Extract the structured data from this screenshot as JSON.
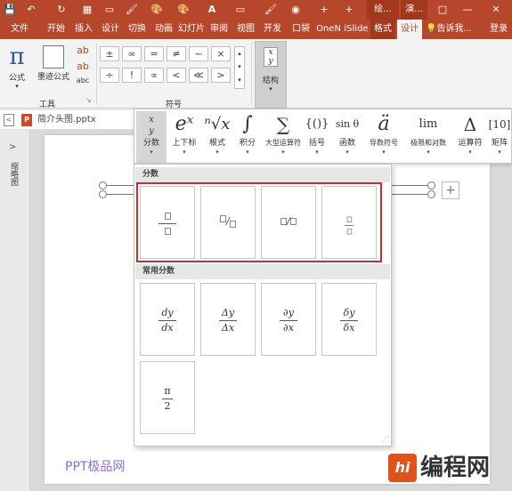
{
  "qat": {
    "title_left": "绘...",
    "title_right": "演...",
    "min": "—",
    "restore": "□",
    "close": "✕",
    "save_glyph": "💾",
    "undo_glyph": "↶",
    "redo_glyph": "↻",
    "grid_glyph": "▦",
    "brush_glyph": "🖌",
    "paint_glyph": "🎨",
    "fontcolor_glyph": "A",
    "box_glyph": "▭",
    "plus_glyph": "+",
    "disk_glyph": "◉"
  },
  "tabs": [
    "文件",
    "开始",
    "插入",
    "设计",
    "切换",
    "动画",
    "幻灯片",
    "审阅",
    "视图",
    "开发",
    "口袋",
    "OneN",
    "iSlide",
    "格式",
    "设计"
  ],
  "tell_me": "告诉我...",
  "login": "登录",
  "ribbon": {
    "equation_label": "公式",
    "ink_label": "墨迹公式",
    "abc_label": "abc",
    "tools_group": "工具",
    "symbols_group": "符号",
    "structure_label": "结构",
    "symbols": [
      "±",
      "∞",
      "=",
      "≠",
      "~",
      "×",
      "÷",
      "!",
      "∝",
      "<",
      "≪",
      ">"
    ],
    "launcher_glyph": "↘",
    "scroll_up": "▴",
    "scroll_down": "▾",
    "scroll_more": "▾",
    "pi_glyph": "π"
  },
  "file": {
    "name": "简介头图.pptx",
    "collapse_glyph": "<"
  },
  "left_panel": {
    "arrow": ">",
    "label": "缩略图"
  },
  "structures": [
    {
      "glyph": "x/y",
      "label": "分数",
      "arrow": "▾"
    },
    {
      "glyph": "eˣ",
      "label": "上下标",
      "arrow": "▾"
    },
    {
      "glyph": "ⁿ√x",
      "label": "根式",
      "arrow": "▾"
    },
    {
      "glyph": "∫",
      "label": "积分",
      "arrow": "▾"
    },
    {
      "glyph": "∑",
      "label": "大型运算符",
      "arrow": "▾"
    },
    {
      "glyph": "{()}",
      "label": "括号",
      "arrow": "▾"
    },
    {
      "glyph": "sin θ",
      "label": "函数",
      "arrow": "▾"
    },
    {
      "glyph": "ä",
      "label": "导数符号",
      "arrow": "▾"
    },
    {
      "glyph": "lim",
      "label": "极限和对数",
      "arrow": "▾"
    },
    {
      "glyph": "Δ",
      "label": "运算符",
      "arrow": "▾"
    },
    {
      "glyph": "[10]",
      "label": "矩阵",
      "arrow": "▾"
    }
  ],
  "dropdown": {
    "section1": "分数",
    "section2": "常用分数",
    "fractions": [
      {
        "name": "stacked"
      },
      {
        "name": "skewed",
        "sep": "/"
      },
      {
        "name": "linear",
        "sep": "/"
      },
      {
        "name": "small"
      }
    ],
    "common": [
      {
        "num": "dy",
        "den": "dx"
      },
      {
        "num": "Δy",
        "den": "Δx"
      },
      {
        "num": "∂y",
        "den": "∂x"
      },
      {
        "num": "δy",
        "den": "δx"
      },
      {
        "num": "π",
        "den": "2"
      }
    ],
    "resize_glyph": "⋰"
  },
  "slide": {
    "add_glyph": "+"
  },
  "watermark": {
    "left": "PPT极品网",
    "right": "编程网",
    "logo": "hi"
  },
  "colors": {
    "accent": "#b7472a",
    "highlight": "#c62f2f"
  }
}
